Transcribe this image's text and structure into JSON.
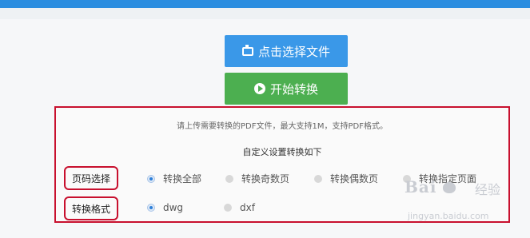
{
  "toolbar": {
    "upload_label": "点击选择文件",
    "start_label": "开始转换"
  },
  "panel": {
    "notice": "请上传需要转换的PDF文件，最大支持1M，支持PDF格式。",
    "custom_title": "自定义设置转换如下"
  },
  "page_selection": {
    "label": "页码选择",
    "options": [
      "转换全部",
      "转换奇数页",
      "转换偶数页",
      "转换指定页面"
    ],
    "selected": "转换全部"
  },
  "output_format": {
    "label": "转换格式",
    "options": [
      "dwg",
      "dxf"
    ],
    "selected": "dwg"
  },
  "watermark": {
    "brand": "Bai",
    "product": "经验",
    "url": "jingyan.baidu.com"
  },
  "colors": {
    "upload_button": "#3a98e8",
    "start_button": "#4caf50",
    "highlight_border": "#c8102e",
    "radio_selected": "#2d7fd9"
  }
}
